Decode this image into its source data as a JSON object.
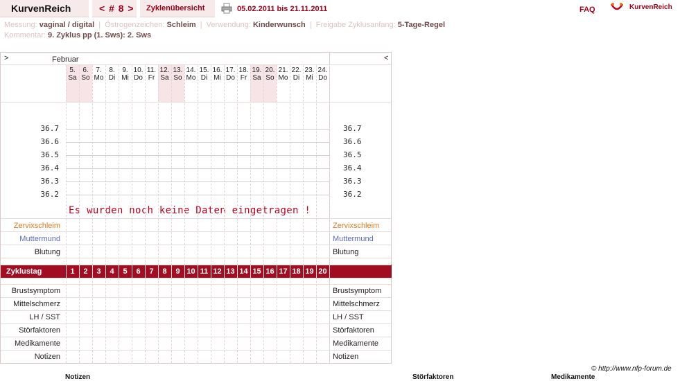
{
  "header": {
    "title": "KurvenReich",
    "cycle_nav": "< # 8 >",
    "cycles_tab": "Zyklenübersicht",
    "date_range": "05.02.2011 bis 21.11.2011",
    "faq": "FAQ",
    "brand": "KurvenReich"
  },
  "info": {
    "messung_label": "Messung:",
    "messung_value": "vaginal / digital",
    "oestrogen_label": "Östrogenzeichen:",
    "oestrogen_value": "Schleim",
    "verwendung_label": "Verwendung:",
    "verwendung_value": "Kinderwunsch",
    "freigabe_label": "Freigabe Zyklusanfang:",
    "freigabe_value": "5-Tage-Regel",
    "kommentar_label": "Kommentar:",
    "kommentar_value": "9. Zyklus pp (1. Sws): 2. Sws"
  },
  "chart": {
    "nav_prev": ">",
    "nav_next": "<",
    "month": "Februar",
    "days": [
      {
        "num": "5.",
        "wd": "Sa",
        "weekend": true
      },
      {
        "num": "6.",
        "wd": "So",
        "weekend": true
      },
      {
        "num": "7.",
        "wd": "Mo",
        "weekend": false
      },
      {
        "num": "8.",
        "wd": "Di",
        "weekend": false
      },
      {
        "num": "9.",
        "wd": "Mi",
        "weekend": false
      },
      {
        "num": "10.",
        "wd": "Do",
        "weekend": false
      },
      {
        "num": "11.",
        "wd": "Fr",
        "weekend": false
      },
      {
        "num": "12.",
        "wd": "Sa",
        "weekend": true
      },
      {
        "num": "13.",
        "wd": "So",
        "weekend": true
      },
      {
        "num": "14.",
        "wd": "Mo",
        "weekend": false
      },
      {
        "num": "15.",
        "wd": "Di",
        "weekend": false
      },
      {
        "num": "16.",
        "wd": "Mi",
        "weekend": false
      },
      {
        "num": "17.",
        "wd": "Do",
        "weekend": false
      },
      {
        "num": "18.",
        "wd": "Fr",
        "weekend": false
      },
      {
        "num": "19.",
        "wd": "Sa",
        "weekend": true
      },
      {
        "num": "20.",
        "wd": "So",
        "weekend": true
      },
      {
        "num": "21.",
        "wd": "Mo",
        "weekend": false
      },
      {
        "num": "22.",
        "wd": "Di",
        "weekend": false
      },
      {
        "num": "23.",
        "wd": "Mi",
        "weekend": false
      },
      {
        "num": "24.",
        "wd": "Do",
        "weekend": false
      }
    ],
    "temperatures": [
      "36.7",
      "36.6",
      "36.5",
      "36.4",
      "36.3",
      "36.2"
    ],
    "no_data_message": "Es wurden noch keine Daten eingetragen !",
    "rows_top": [
      {
        "label": "Zervixschleim",
        "color": "orange"
      },
      {
        "label": "Muttermund",
        "color": "blue"
      },
      {
        "label": "Blutung",
        "color": ""
      }
    ],
    "cycle_label": "Zyklustag",
    "cycle_days": [
      "1",
      "2",
      "3",
      "4",
      "5",
      "6",
      "7",
      "8",
      "9",
      "10",
      "11",
      "12",
      "13",
      "14",
      "15",
      "16",
      "17",
      "18",
      "19",
      "20"
    ],
    "rows_bottom": [
      "Brustsymptom",
      "Mittelschmerz",
      "LH / SST",
      "Störfaktoren",
      "Medikamente",
      "Notizen"
    ]
  },
  "footer": {
    "link": "© http://www.nfp-forum.de",
    "cut_notizen": "Notizen",
    "cut_stoerfaktoren": "Störfaktoren",
    "cut_medikamente": "Medikamente"
  }
}
